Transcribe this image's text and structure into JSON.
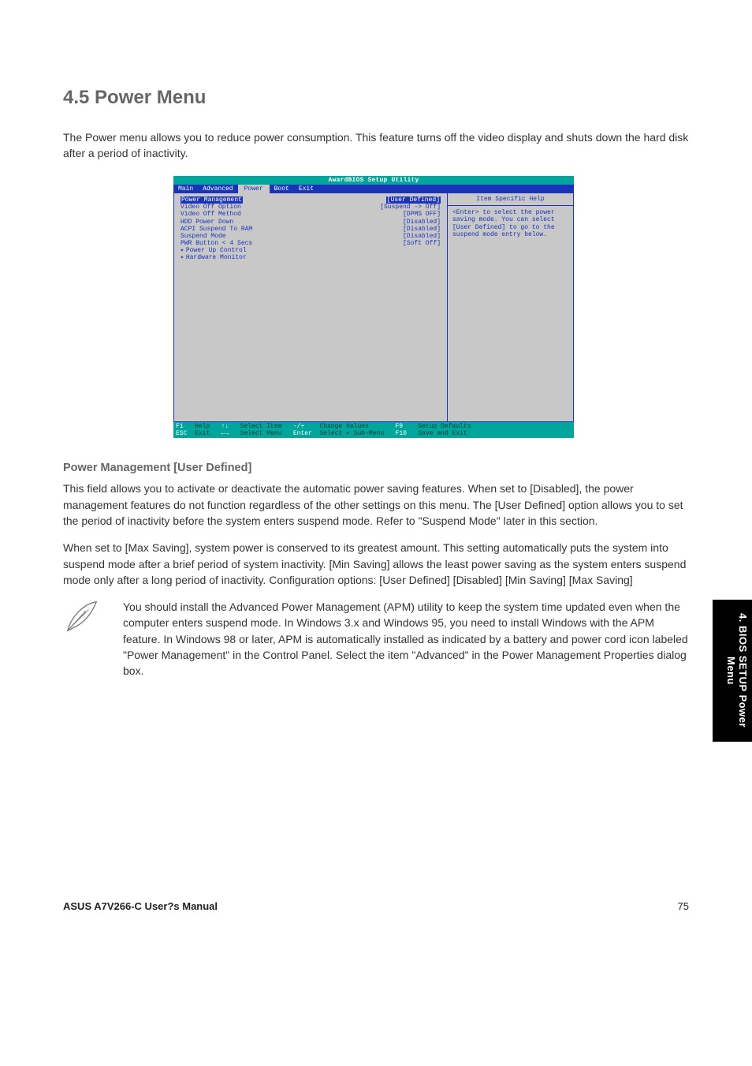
{
  "section_title": "4.5 Power Menu",
  "intro_text": "The Power menu allows you to reduce power consumption. This feature turns off the video display and shuts down the hard disk after a period of inactivity.",
  "bios": {
    "title": "AwardBIOS Setup Utility",
    "tabs": [
      "Main",
      "Advanced",
      "Power",
      "Boot",
      "Exit"
    ],
    "active_tab_index": 2,
    "rows": [
      {
        "label": "Power Management",
        "value": "[User Defined]",
        "highlighted": true
      },
      {
        "label": "Video Off Option",
        "value": "[Suspend -> Off]"
      },
      {
        "label": "Video Off Method",
        "value": "[DPMS OFF]"
      },
      {
        "label": "HDD Power Down",
        "value": "[Disabled]"
      },
      {
        "label": "ACPI Suspend To RAM",
        "value": "[Disabled]"
      },
      {
        "label": "Suspend Mode",
        "value": "[Disabled]"
      },
      {
        "label": "PWR Button < 4 Secs",
        "value": "[Soft Off]"
      },
      {
        "label": "Power Up Control",
        "value": "",
        "submenu": true
      },
      {
        "label": "Hardware Monitor",
        "value": "",
        "submenu": true
      }
    ],
    "help_title": "Item Specific Help",
    "help_body": "<Enter> to select the power saving mode. You can select [User Defined] to go to the suspend mode entry below.",
    "footer": {
      "f1": "F1",
      "f1_label": "Help",
      "esc": "ESC",
      "esc_label": "Exit",
      "updown": "↑↓",
      "updown_label": "Select Item",
      "leftright": "←→",
      "leftright_label": "Select Menu",
      "minusplus": "-/+",
      "minusplus_label": "Change Values",
      "enter": "Enter",
      "enter_label": "Select ▸ Sub-Menu",
      "f9": "F9",
      "f9_label": "Setup Defaults",
      "f10": "F10",
      "f10_label": "Save and Exit"
    }
  },
  "items": [
    {
      "head": "Power Management [User Defined]",
      "body": "This field allows you to activate or deactivate the automatic power saving features. When set to [Disabled], the power management features do not function regardless of the other settings on this menu. The [User Defined] option allows you to set the period of inactivity before the system enters suspend mode. Refer to \"Suspend Mode\" later in this section.",
      "body2": "When set to [Max Saving], system power is conserved to its greatest amount. This setting automatically puts the system into suspend mode after a brief period of system inactivity. [Min Saving] allows the least power saving as the system enters suspend mode only after a long period of inactivity. Configuration options: [User Defined] [Disabled] [Min Saving] [Max Saving]"
    }
  ],
  "note_text": "You should install the Advanced Power Management (APM) utility to keep the system time updated even when the computer enters suspend mode. In Windows 3.x and Windows 95, you need to install Windows with the APM feature. In Windows 98 or later, APM is automatically installed as indicated by a battery and power cord icon labeled \"Power Management\" in the Control Panel. Select the item \"Advanced\" in the Power Management Properties dialog box.",
  "side_tab": "4. BIOS SETUP\nPower Menu",
  "footer_left": "ASUS A7V266-C User?s Manual",
  "footer_right": "75"
}
